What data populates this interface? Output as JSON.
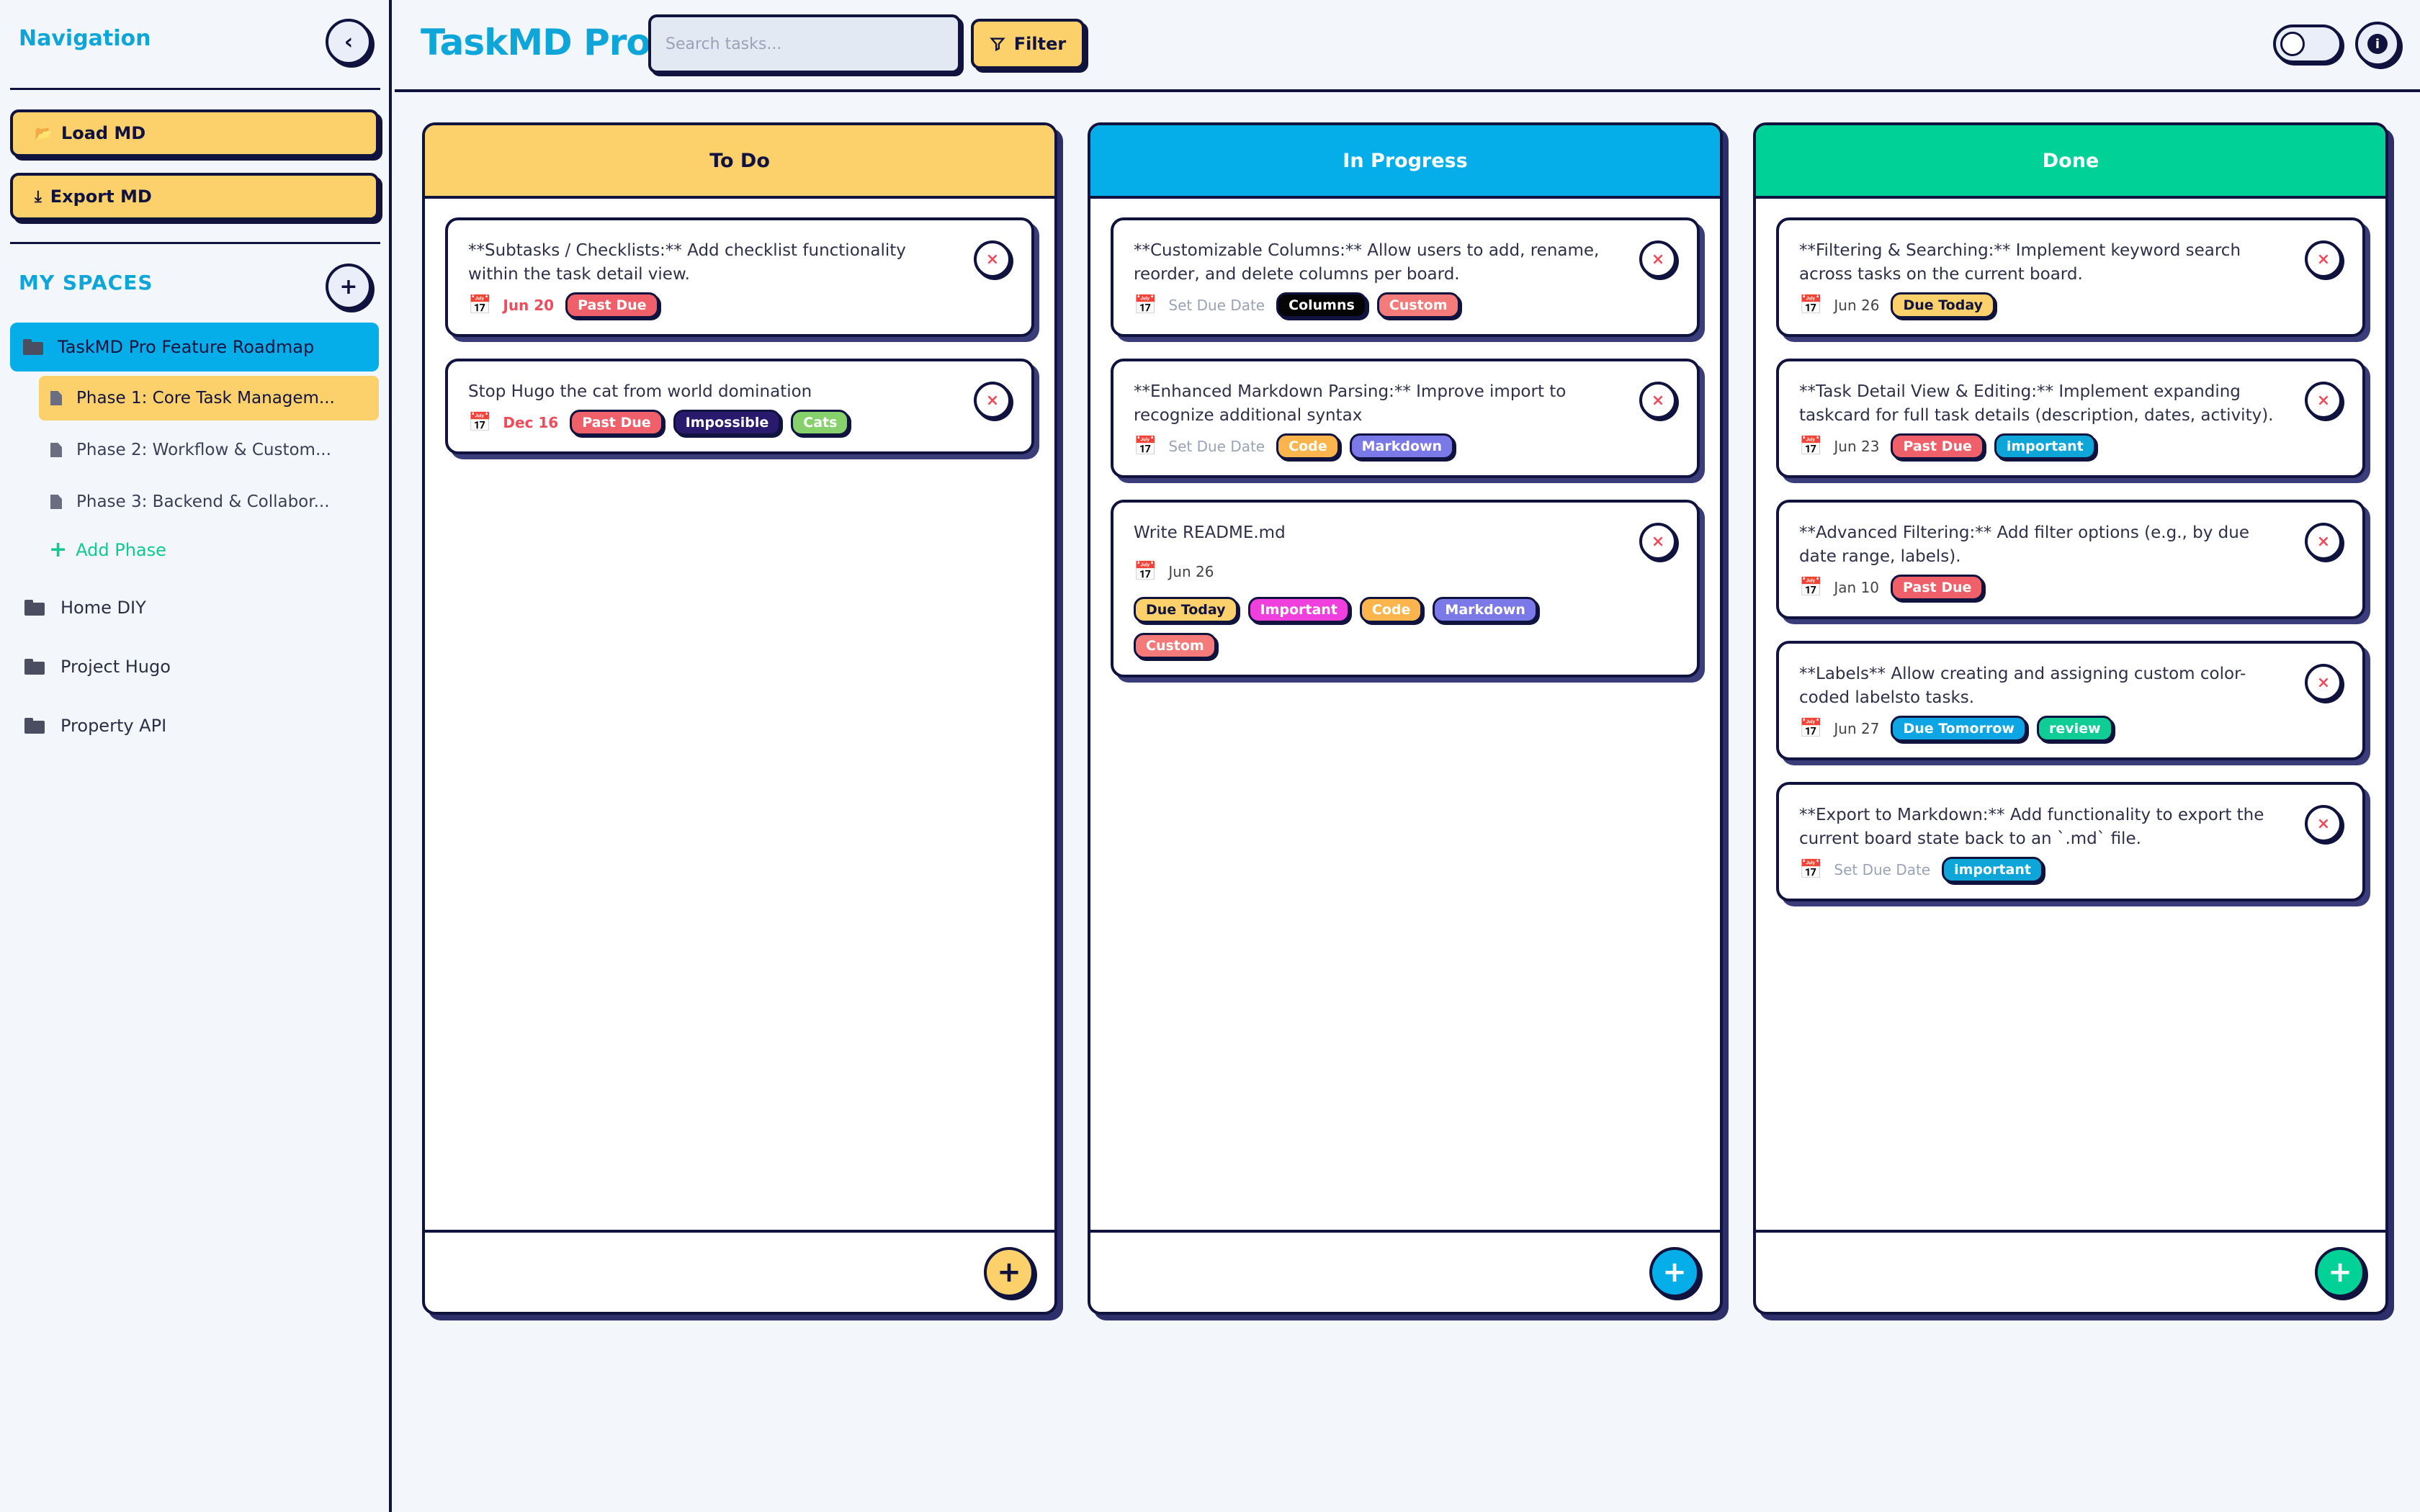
{
  "colors": {
    "navy": "#11133f",
    "accent_blue": "#0ea5d9",
    "yellow": "#fcd06a",
    "progress_blue": "#06aee9",
    "done_green": "#00d196",
    "overdue_red": "#f04b5a"
  },
  "sidebar": {
    "title": "Navigation",
    "collapse_icon": "chevron-left-icon",
    "load_label": "Load MD",
    "export_label": "Export MD",
    "section_label": "MY SPACES",
    "add_space_icon": "plus-icon",
    "active_space": "TaskMD Pro Feature Roadmap",
    "phases": [
      "Phase 1: Core Task Managem...",
      "Phase 2: Workflow & Custom...",
      "Phase 3: Backend & Collabor..."
    ],
    "add_phase_label": "Add Phase",
    "spaces": [
      "Home DIY",
      "Project Hugo",
      "Property API"
    ]
  },
  "header": {
    "app_title": "TaskMD Pro",
    "search_placeholder": "Search tasks...",
    "filter_label": "Filter",
    "theme_toggle": "off",
    "info_icon": "info-icon"
  },
  "columns": [
    {
      "title": "To Do",
      "cards": [
        {
          "text": "**Subtasks / Checklists:** Add checklist functionality within the task detail view.",
          "date": "Jun 20",
          "tags": [
            "Past Due"
          ]
        },
        {
          "text": "Stop Hugo the cat from world domination",
          "date": "Dec 16",
          "tags": [
            "Past Due",
            "Impossible",
            "Cats"
          ]
        }
      ]
    },
    {
      "title": "In Progress",
      "cards": [
        {
          "text": "**Customizable Columns:** Allow users to add, rename, reorder, and delete columns per board.",
          "date": "Set Due Date",
          "tags": [
            "Columns",
            "Custom"
          ]
        },
        {
          "text": "**Enhanced Markdown Parsing:** Improve import to recognize additional syntax",
          "date": "Set Due Date",
          "tags": [
            "Code",
            "Markdown"
          ]
        },
        {
          "text": "Write README.md",
          "date": "Jun 26",
          "tags": [
            "Due Today",
            "Important",
            "Code",
            "Markdown",
            "Custom"
          ]
        }
      ]
    },
    {
      "title": "Done",
      "cards": [
        {
          "text": "**Filtering & Searching:** Implement keyword search across tasks on the current board.",
          "date": "Jun 26",
          "tags": [
            "Due Today"
          ]
        },
        {
          "text": "**Task Detail View & Editing:** Implement expanding taskcard for full task details (description, dates, activity).",
          "date": "Jun 23",
          "tags": [
            "Past Due",
            "important"
          ]
        },
        {
          "text": "**Advanced Filtering:** Add filter options (e.g., by due date range, labels).",
          "date": "Jan 10",
          "tags": [
            "Past Due"
          ]
        },
        {
          "text": "**Labels** Allow creating and assigning custom color-coded labelsto tasks.",
          "date": "Jun 27",
          "tags": [
            "Due Tomorrow",
            "review"
          ]
        },
        {
          "text": "**Export to Markdown:** Add functionality to export the current board state back to an `.md` file.",
          "date": "Set Due Date",
          "tags": [
            "important"
          ]
        }
      ]
    }
  ]
}
